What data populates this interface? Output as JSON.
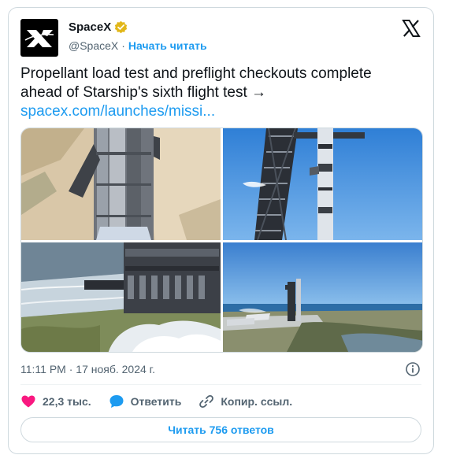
{
  "author": {
    "display_name": "SpaceX",
    "handle": "@SpaceX",
    "separator": "·",
    "follow_label": "Начать читать"
  },
  "tweet": {
    "text": "Propellant load test and preflight checkouts complete ahead of Starship's sixth flight test →",
    "link": "spacex.com/launches/missi..."
  },
  "media": [
    {
      "icon": "starship-closeup-photo"
    },
    {
      "icon": "launch-tower-photo"
    },
    {
      "icon": "booster-base-photo"
    },
    {
      "icon": "launch-site-aerial-photo"
    }
  ],
  "meta": {
    "timestamp": "11:11 PM · 17 нояб. 2024 г."
  },
  "actions": {
    "likes": "22,3 тыс.",
    "reply_label": "Ответить",
    "copy_link_label": "Копир. ссыл."
  },
  "read_replies_label": "Читать 756 ответов",
  "colors": {
    "accent": "#1d9bf0",
    "like": "#f91880",
    "text": "#0f1419",
    "secondary": "#536471",
    "verified": "#e2b719"
  }
}
